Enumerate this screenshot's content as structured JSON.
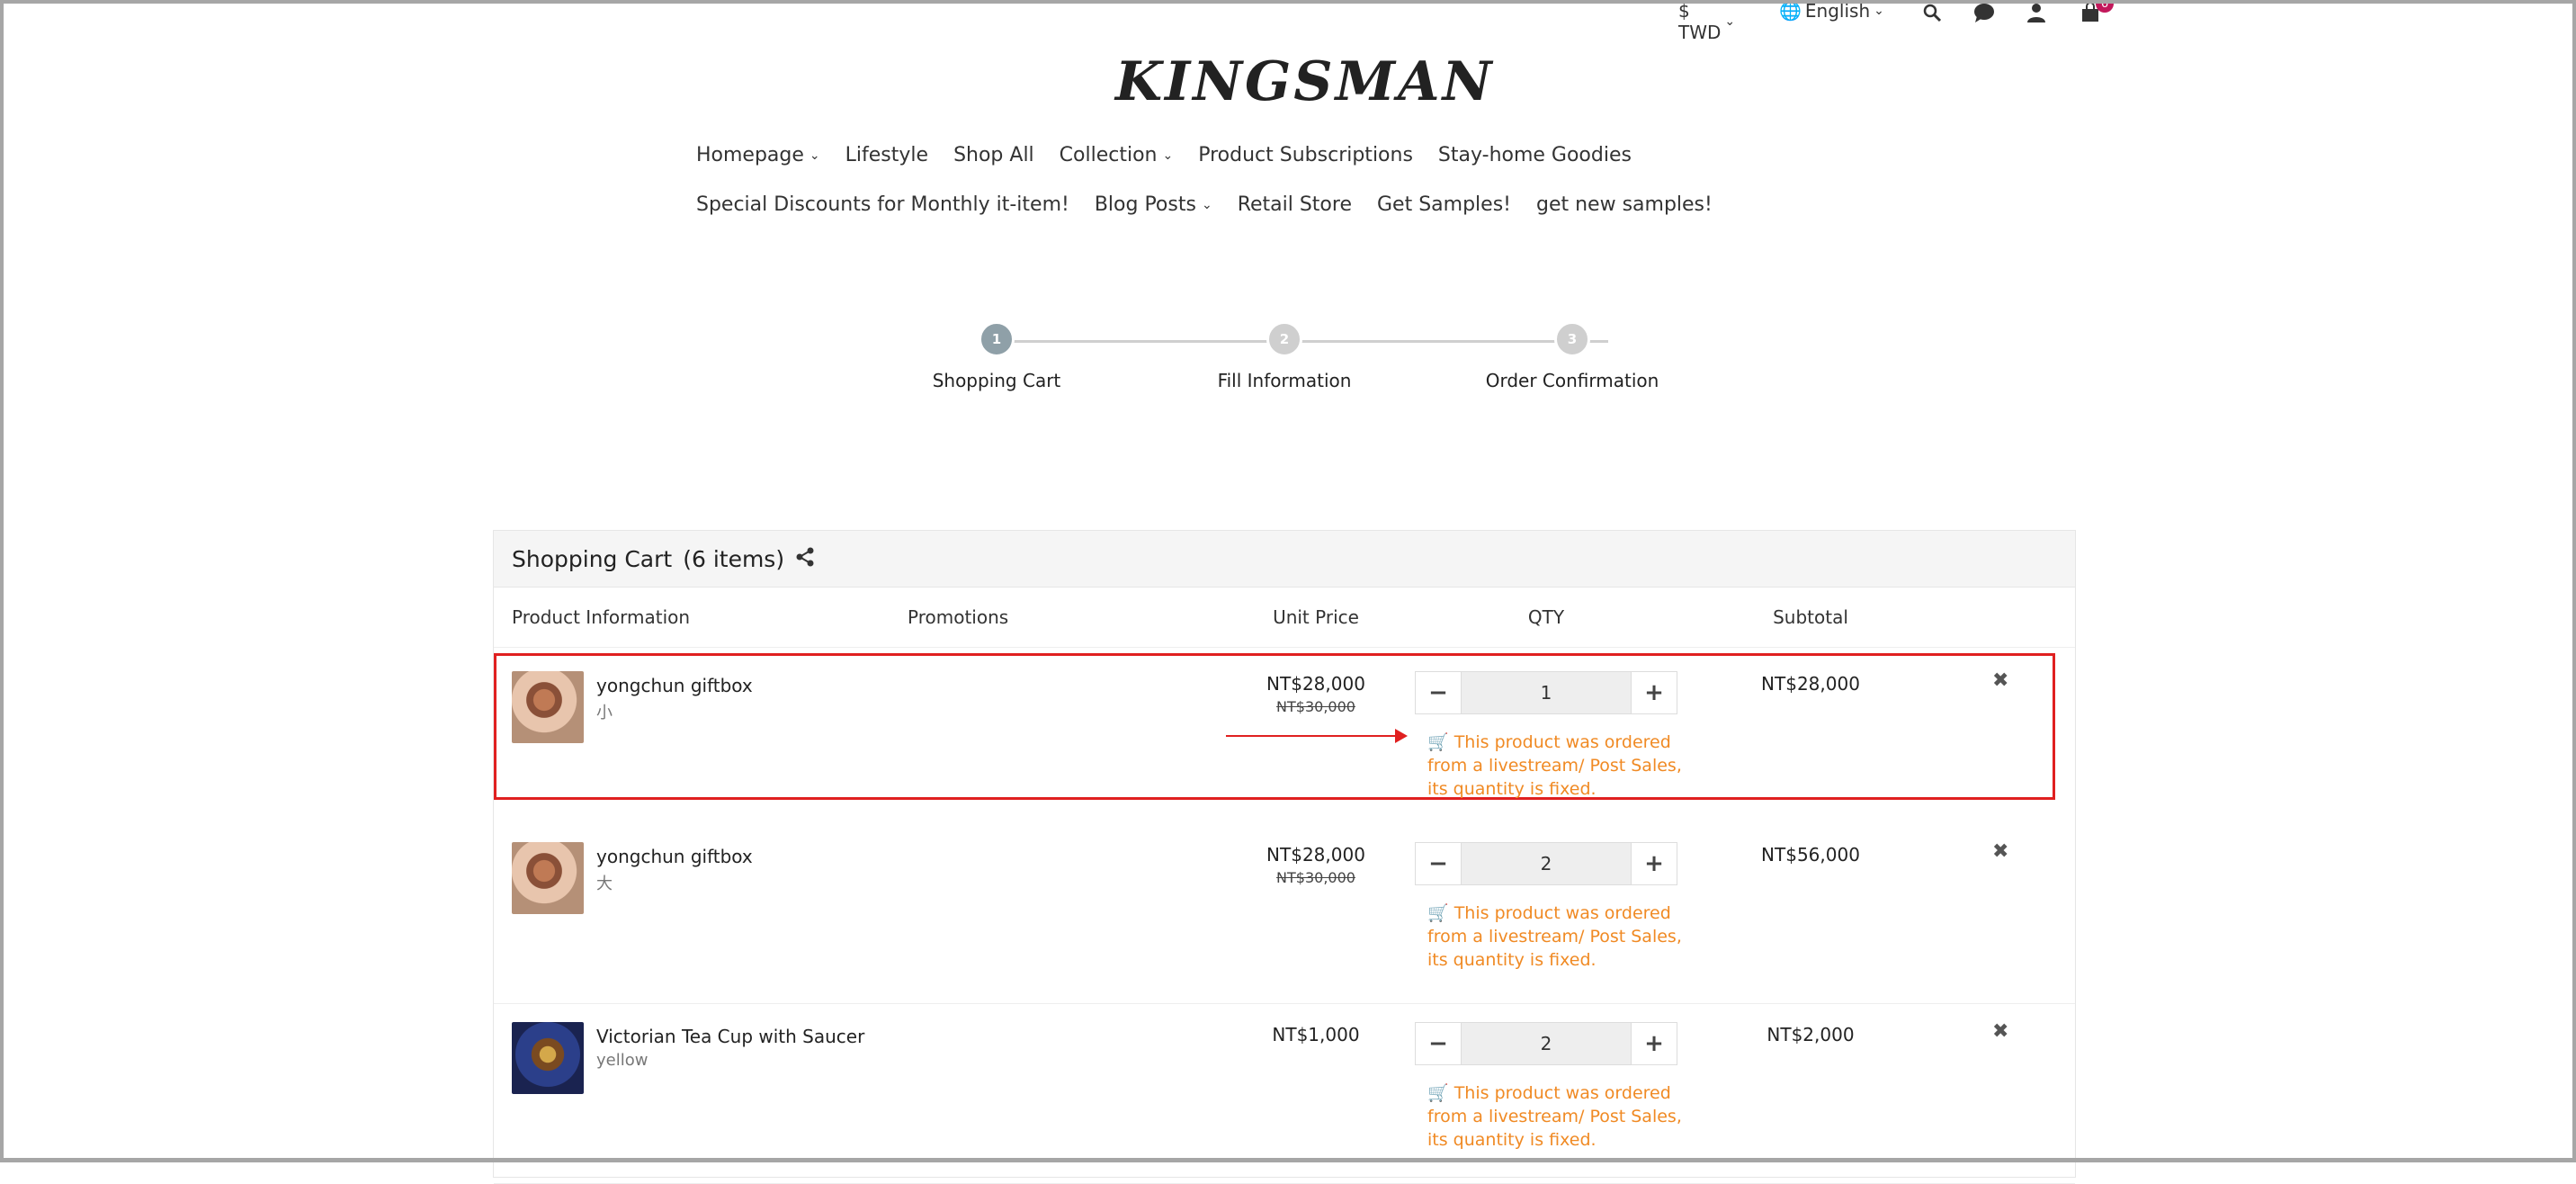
{
  "utility": {
    "currency": "$ TWD",
    "language": "English",
    "cart_count": "6"
  },
  "logo": "KINGSMAN",
  "nav": {
    "row1": [
      "Homepage",
      "Lifestyle",
      "Shop All",
      "Collection",
      "Product Subscriptions",
      "Stay-home Goodies"
    ],
    "row2": [
      "Special Discounts for Monthly it-item!",
      "Blog Posts",
      "Retail Store",
      "Get Samples!",
      "get new samples!"
    ]
  },
  "steps": [
    {
      "num": "1",
      "label": "Shopping Cart"
    },
    {
      "num": "2",
      "label": "Fill Information"
    },
    {
      "num": "3",
      "label": "Order Confirmation"
    }
  ],
  "cart": {
    "title": "Shopping Cart",
    "count": "(6 items)",
    "columns": {
      "product": "Product Information",
      "promotions": "Promotions",
      "unit_price": "Unit Price",
      "qty": "QTY",
      "subtotal": "Subtotal"
    },
    "items": [
      {
        "name": "yongchun giftbox",
        "variant": "小",
        "price": "NT$28,000",
        "old_price": "NT$30,000",
        "qty": "1",
        "subtotal": "NT$28,000",
        "note": "This product was ordered from a livestream/ Post Sales, its quantity is fixed."
      },
      {
        "name": "yongchun giftbox",
        "variant": "大",
        "price": "NT$28,000",
        "old_price": "NT$30,000",
        "qty": "2",
        "subtotal": "NT$56,000",
        "note": "This product was ordered from a livestream/ Post Sales, its quantity is fixed."
      },
      {
        "name": "Victorian Tea Cup with Saucer",
        "variant": "yellow",
        "price": "NT$1,000",
        "old_price": "",
        "qty": "2",
        "subtotal": "NT$2,000",
        "note": "This product was ordered from a livestream/ Post Sales, its quantity is fixed."
      }
    ]
  }
}
